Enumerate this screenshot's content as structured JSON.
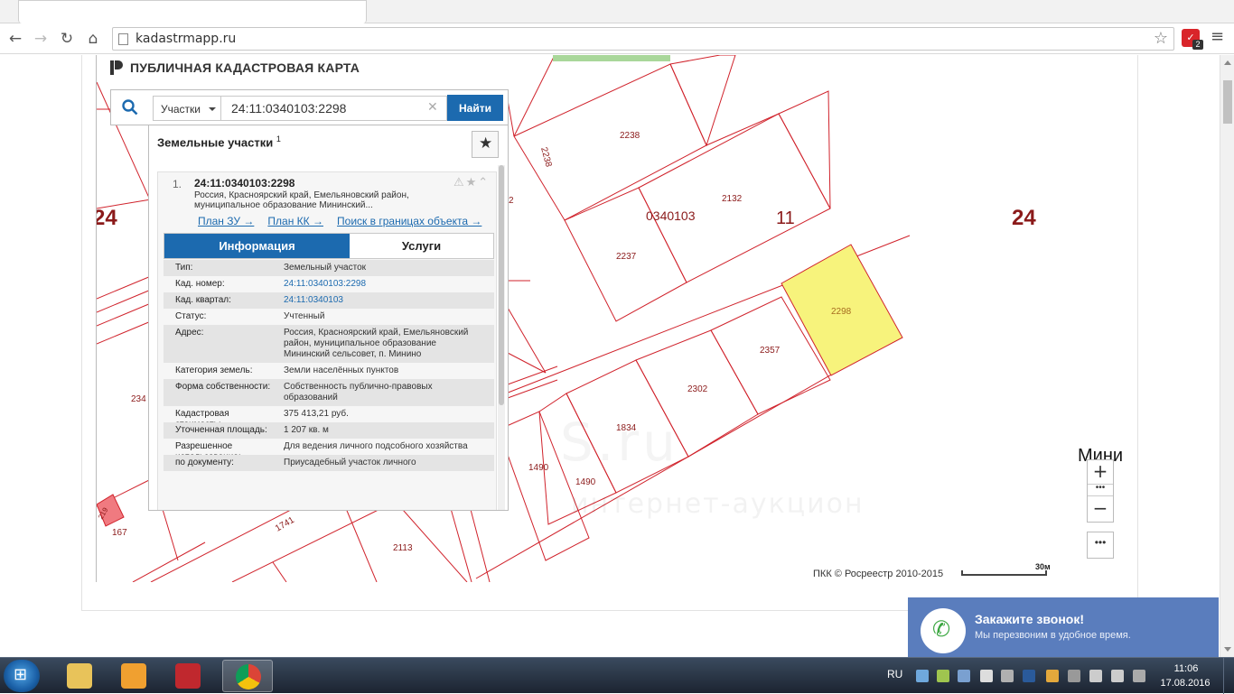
{
  "browser": {
    "url": "kadastrmapp.ru",
    "ext_badge": "2"
  },
  "brand": {
    "title": "ПУБЛИЧНАЯ КАДАСТРОВАЯ КАРТА"
  },
  "search": {
    "type_label": "Участки",
    "query": "24:11:0340103:2298",
    "find_label": "Найти"
  },
  "results": {
    "title": "Земельные участки",
    "count": "1",
    "item": {
      "index": "1.",
      "cad_number": "24:11:0340103:2298",
      "address": "Россия, Красноярский край, Емельяновский район, муниципальное образование Мининский...",
      "links": [
        "План ЗУ →",
        "План КК →",
        "Поиск в границах объекта →"
      ]
    },
    "tabs": [
      "Информация",
      "Услуги"
    ],
    "properties": [
      {
        "key": "Тип:",
        "value": "Земельный участок",
        "link": false
      },
      {
        "key": "Кад. номер:",
        "value": "24:11:0340103:2298",
        "link": true
      },
      {
        "key": "Кад. квартал:",
        "value": "24:11:0340103",
        "link": true
      },
      {
        "key": "Статус:",
        "value": "Учтенный",
        "link": false
      },
      {
        "key": "Адрес:",
        "value": "Россия, Красноярский край, Емельяновский район, муниципальное образование Мининский сельсовет, п. Минино",
        "link": false
      },
      {
        "key": "Категория земель:",
        "value": "Земли населённых пунктов",
        "link": false
      },
      {
        "key": "Форма собственности:",
        "value": "Собственность публично-правовых образований",
        "link": false
      },
      {
        "key": "Кадастровая стоимость:",
        "value": "375 413,21 руб.",
        "link": false
      },
      {
        "key": "Уточненная площадь:",
        "value": "1 207 кв. м",
        "link": false
      },
      {
        "key": "Разрешенное использование:",
        "value": "Для ведения личного подсобного хозяйства",
        "link": false
      },
      {
        "key": "по документу:",
        "value": "Приусадебный участок личного",
        "link": false
      }
    ]
  },
  "map": {
    "labels": {
      "l2238a": "2238",
      "l2238b": "2238",
      "l2132": "2132",
      "l0340103": "0340103",
      "l11": "11",
      "l24a": "24",
      "l24b": "24",
      "l2237": "2237",
      "l2298": "2298",
      "l2357": "2357",
      "l2302": "2302",
      "l1834": "1834",
      "l1490a": "1490",
      "l1490b": "1490",
      "l234": "234",
      "l2113": "2113",
      "l1741": "1741",
      "l167": "167",
      "l219": "219",
      "l2": "2"
    },
    "place": "Мини",
    "copyright": "ПКК © Росреестр 2010-2015",
    "scale": "30м",
    "watermark": "S.ru",
    "watermark2": "интернет-аукцион",
    "colors": {
      "boundary": "#d0222b",
      "selected": "#f7f37c"
    }
  },
  "callback": {
    "title": "Закажите звонок!",
    "subtitle": "Мы перезвоним в удобное время."
  },
  "taskbar": {
    "lang": "RU",
    "time": "11:06",
    "date": "17.08.2016"
  }
}
